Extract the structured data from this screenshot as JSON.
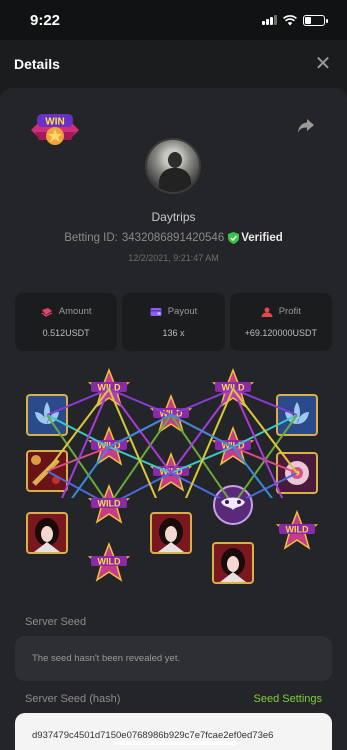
{
  "status_bar": {
    "time": "9:22"
  },
  "header": {
    "title": "Details"
  },
  "profile": {
    "username": "Daytrips",
    "betting_id_label": "Betting ID:",
    "betting_id": "3432086891420546",
    "verified_label": "Verified",
    "datetime": "12/2/2021, 9:21:47 AM"
  },
  "stats": [
    {
      "label": "Amount",
      "value": "0.512USDT",
      "icon": "coins-icon"
    },
    {
      "label": "Payout",
      "value": "136 x",
      "icon": "wallet-icon"
    },
    {
      "label": "Profit",
      "value": "+69.120000USDT",
      "icon": "profit-icon"
    }
  ],
  "win_badge": {
    "text": "WIN"
  },
  "reel_win_text": "WILD",
  "server_seed": {
    "label": "Server Seed",
    "value": "The seed hasn't been revealed yet."
  },
  "server_seed_hash": {
    "label": "Server Seed (hash)",
    "settings_label": "Seed Settings",
    "value": "d937479c4501d7150e0768986b929c7e7fcae2ef0ed73e6"
  },
  "colors": {
    "background": "#1b1c1e",
    "card": "#242528",
    "accent_green": "#7fd03a",
    "verified_green": "#3bc14a"
  }
}
